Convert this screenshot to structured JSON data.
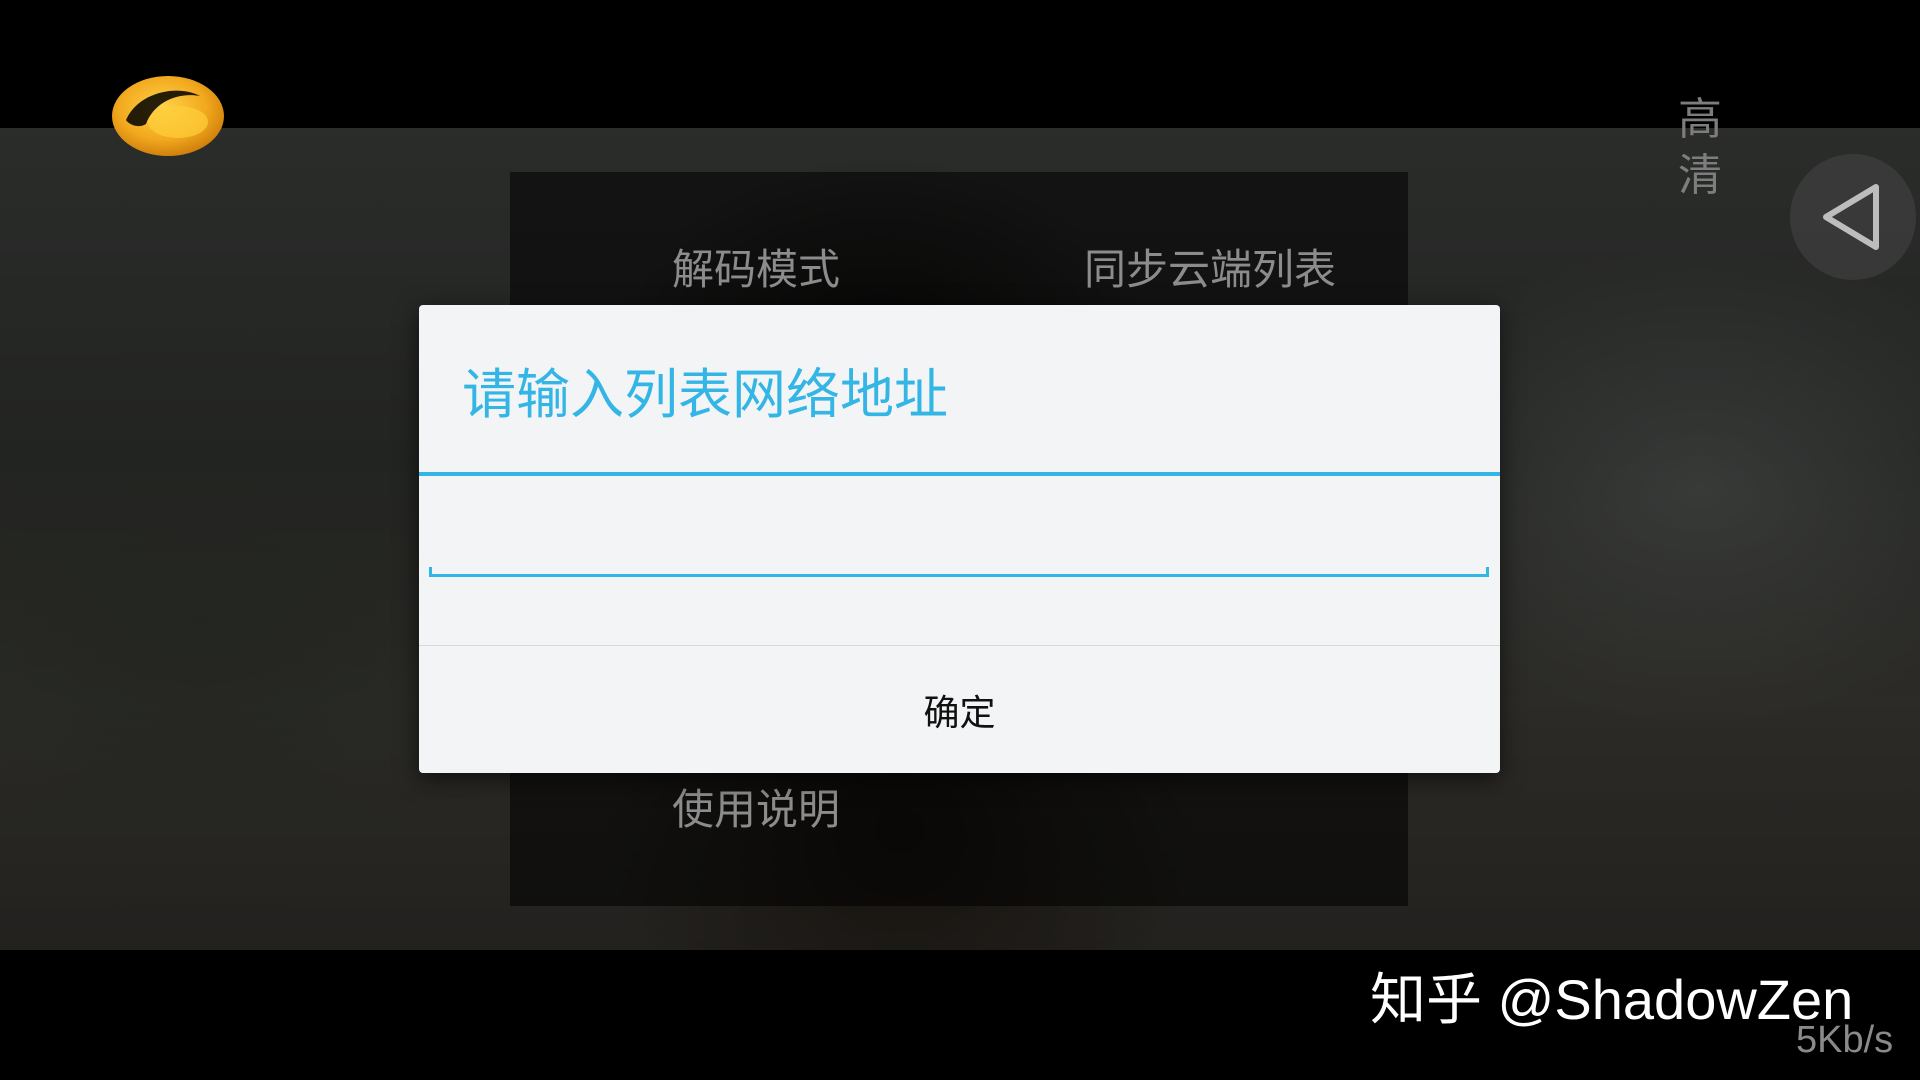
{
  "player": {
    "quality_label": "高 清",
    "network_speed": "5Kb/s",
    "logo_icon": "hunan-tv-mango-logo",
    "back_icon": "back-triangle-icon"
  },
  "menu": {
    "items": [
      {
        "label": "解码模式"
      },
      {
        "label": "同步云端列表"
      },
      {
        "label": "使用说明"
      }
    ]
  },
  "dialog": {
    "title": "请输入列表网络地址",
    "input_value": "",
    "input_placeholder": "",
    "confirm_label": "确定",
    "accent_color": "#33b5e5"
  },
  "watermark": {
    "text": "知乎 @ShadowZen"
  }
}
